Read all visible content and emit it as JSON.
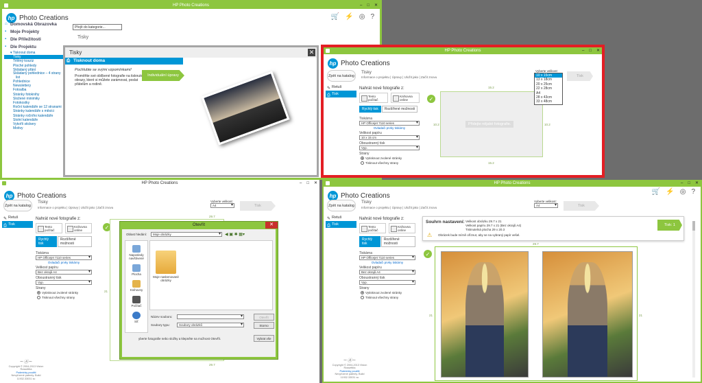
{
  "app": {
    "title": "HP Photo Creations",
    "logo": "hp",
    "name": "Photo Creations",
    "icons": [
      "cart-icon",
      "lightning-icon",
      "globe-icon",
      "help-icon"
    ]
  },
  "p1": {
    "nav": [
      {
        "label": "Domovská Obrazovka",
        "icon": "home-icon"
      },
      {
        "label": "Moje Projekty",
        "icon": "folder-icon"
      },
      {
        "label": "Dle Příležitosti",
        "icon": "calendar-icon"
      },
      {
        "label": "Dle Projektu",
        "icon": "grid-icon"
      }
    ],
    "sub_header": "▾ Tisknout doma",
    "sub": [
      "Tisky",
      "Tělěný kosziz",
      "Ploché pohledy",
      "Skládaný přání",
      "Skládaný pohlednice – 4 strany",
      "list",
      "Pohlednice",
      "Newslettery",
      "Fotoalba",
      "Stránky fotoknihy",
      "Složené minimiky",
      "Fotokostky",
      "Roční kalendáře se 12 stranami",
      "Stránky kalendáře s měsíci",
      "Stránky ročního kalendáře",
      "Stolní kalendáře",
      "Vykoříi stickery",
      "Motivy"
    ],
    "category_dropdown": "Přejít do kategorie...",
    "section": "Tisky",
    "dialog": {
      "title": "Tisky",
      "bar": "Tisknout doma",
      "line1": "Pochlubte se svými vzpomínkami!",
      "line2": "Proměňte své oblíbené fotografie na tisknuté obrazy, které si můžete zarámovat, poslat přátelům a rodině.",
      "button": "Individuální úpravy"
    }
  },
  "editor": {
    "back": "Zpět na katalog",
    "title": "Tisky",
    "breadcrumb": "Informace o projektu | Úpravy | Uložit jako | Začít znovu",
    "nav": [
      "Retuš",
      "Tisk"
    ],
    "upload_header": "Nahrát nové fotografie z:",
    "sources": [
      "Tento počítač",
      "Knihovna online"
    ],
    "tabs": [
      "Rychlý tisk",
      "Rozšířené možnosti"
    ],
    "printer_label": "Tiskárna",
    "printer": "HP Officejet 7110 series",
    "printer_link": "Ovladači prvky tiskárny",
    "paper_label": "Velikost papíru",
    "duplex_label": "Oboustranný tisk",
    "duplex": "Vyp.",
    "pages_label": "Strany",
    "radio1": "Vytisknout zvolené stránky",
    "radio2": "Tisknout všechny strany",
    "size_label": "Vyberte velikost:",
    "print_button": "Tisk",
    "footer1": "Copyright © 2004-2013 Vision Rossettita",
    "footer2": "Podmínky použití",
    "footer3": "Nevyřízené patenty. Build 11932.33031 sc"
  },
  "p2": {
    "paper": "10 x 15 cm",
    "size": "10 x 15cm",
    "sizes": [
      "10 x 15cm",
      "13 x 18cm",
      "20 x 25cm",
      "22 x 28cm",
      "A4",
      "28 x 43cm",
      "33 x 48cm"
    ],
    "placeholder": "Přidejte nějaké fotografie.",
    "dim_w": "15.2",
    "dim_h": "10.2"
  },
  "p3": {
    "paper": "Bez okrajů A4",
    "size": "A4",
    "dim_w": "29.7",
    "dim_h": "21",
    "dialog": {
      "title": "Otevřít",
      "lookin_label": "Oblast hledání:",
      "lookin": "Moje obrázky",
      "places": [
        "Naposledy navštívené",
        "Plocha",
        "Knihovny",
        "Počítač",
        "Síť"
      ],
      "folder": "Moje naskenované obrázky",
      "filename_label": "Název souboru:",
      "filetype_label": "Soubory typu:",
      "filetype": "Soubory obrázků",
      "open": "Otevřít",
      "cancel": "Storno",
      "hint": "yberte fotografie nebo složky a klepněte na možnost Otevřít.",
      "choose_all": "Vybrat vše"
    }
  },
  "p4": {
    "paper": "Bez okrajů A4",
    "size": "A4",
    "print_button": "Tisk: 1",
    "summary_title": "Souhrn nastavení:",
    "s1": "Velikost obrázku 29.7 x 21",
    "s2": "Velikost papíru 29.7 x 21 (Bez okrajů A4)",
    "s3": "Tisknutelná plocha 29 x 20.3",
    "warn": "Obrázek bude mírně oříznut, aby se na vybraný papír vešel.",
    "dim_w": "29.7",
    "dim_h": "21"
  }
}
